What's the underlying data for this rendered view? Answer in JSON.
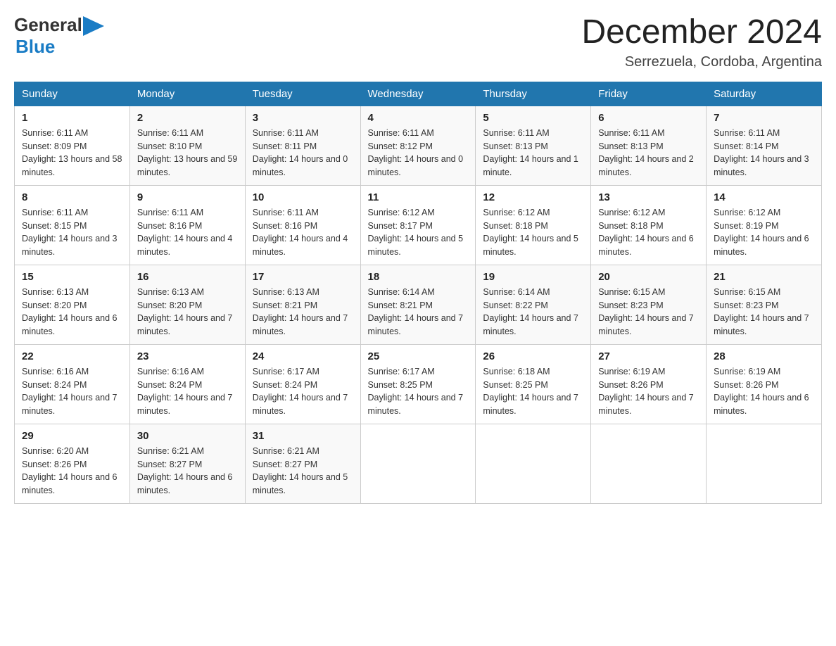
{
  "header": {
    "logo_general": "General",
    "logo_blue": "Blue",
    "title": "December 2024",
    "location": "Serrezuela, Cordoba, Argentina"
  },
  "days_of_week": [
    "Sunday",
    "Monday",
    "Tuesday",
    "Wednesday",
    "Thursday",
    "Friday",
    "Saturday"
  ],
  "weeks": [
    [
      {
        "day": "1",
        "sunrise": "Sunrise: 6:11 AM",
        "sunset": "Sunset: 8:09 PM",
        "daylight": "Daylight: 13 hours and 58 minutes."
      },
      {
        "day": "2",
        "sunrise": "Sunrise: 6:11 AM",
        "sunset": "Sunset: 8:10 PM",
        "daylight": "Daylight: 13 hours and 59 minutes."
      },
      {
        "day": "3",
        "sunrise": "Sunrise: 6:11 AM",
        "sunset": "Sunset: 8:11 PM",
        "daylight": "Daylight: 14 hours and 0 minutes."
      },
      {
        "day": "4",
        "sunrise": "Sunrise: 6:11 AM",
        "sunset": "Sunset: 8:12 PM",
        "daylight": "Daylight: 14 hours and 0 minutes."
      },
      {
        "day": "5",
        "sunrise": "Sunrise: 6:11 AM",
        "sunset": "Sunset: 8:13 PM",
        "daylight": "Daylight: 14 hours and 1 minute."
      },
      {
        "day": "6",
        "sunrise": "Sunrise: 6:11 AM",
        "sunset": "Sunset: 8:13 PM",
        "daylight": "Daylight: 14 hours and 2 minutes."
      },
      {
        "day": "7",
        "sunrise": "Sunrise: 6:11 AM",
        "sunset": "Sunset: 8:14 PM",
        "daylight": "Daylight: 14 hours and 3 minutes."
      }
    ],
    [
      {
        "day": "8",
        "sunrise": "Sunrise: 6:11 AM",
        "sunset": "Sunset: 8:15 PM",
        "daylight": "Daylight: 14 hours and 3 minutes."
      },
      {
        "day": "9",
        "sunrise": "Sunrise: 6:11 AM",
        "sunset": "Sunset: 8:16 PM",
        "daylight": "Daylight: 14 hours and 4 minutes."
      },
      {
        "day": "10",
        "sunrise": "Sunrise: 6:11 AM",
        "sunset": "Sunset: 8:16 PM",
        "daylight": "Daylight: 14 hours and 4 minutes."
      },
      {
        "day": "11",
        "sunrise": "Sunrise: 6:12 AM",
        "sunset": "Sunset: 8:17 PM",
        "daylight": "Daylight: 14 hours and 5 minutes."
      },
      {
        "day": "12",
        "sunrise": "Sunrise: 6:12 AM",
        "sunset": "Sunset: 8:18 PM",
        "daylight": "Daylight: 14 hours and 5 minutes."
      },
      {
        "day": "13",
        "sunrise": "Sunrise: 6:12 AM",
        "sunset": "Sunset: 8:18 PM",
        "daylight": "Daylight: 14 hours and 6 minutes."
      },
      {
        "day": "14",
        "sunrise": "Sunrise: 6:12 AM",
        "sunset": "Sunset: 8:19 PM",
        "daylight": "Daylight: 14 hours and 6 minutes."
      }
    ],
    [
      {
        "day": "15",
        "sunrise": "Sunrise: 6:13 AM",
        "sunset": "Sunset: 8:20 PM",
        "daylight": "Daylight: 14 hours and 6 minutes."
      },
      {
        "day": "16",
        "sunrise": "Sunrise: 6:13 AM",
        "sunset": "Sunset: 8:20 PM",
        "daylight": "Daylight: 14 hours and 7 minutes."
      },
      {
        "day": "17",
        "sunrise": "Sunrise: 6:13 AM",
        "sunset": "Sunset: 8:21 PM",
        "daylight": "Daylight: 14 hours and 7 minutes."
      },
      {
        "day": "18",
        "sunrise": "Sunrise: 6:14 AM",
        "sunset": "Sunset: 8:21 PM",
        "daylight": "Daylight: 14 hours and 7 minutes."
      },
      {
        "day": "19",
        "sunrise": "Sunrise: 6:14 AM",
        "sunset": "Sunset: 8:22 PM",
        "daylight": "Daylight: 14 hours and 7 minutes."
      },
      {
        "day": "20",
        "sunrise": "Sunrise: 6:15 AM",
        "sunset": "Sunset: 8:23 PM",
        "daylight": "Daylight: 14 hours and 7 minutes."
      },
      {
        "day": "21",
        "sunrise": "Sunrise: 6:15 AM",
        "sunset": "Sunset: 8:23 PM",
        "daylight": "Daylight: 14 hours and 7 minutes."
      }
    ],
    [
      {
        "day": "22",
        "sunrise": "Sunrise: 6:16 AM",
        "sunset": "Sunset: 8:24 PM",
        "daylight": "Daylight: 14 hours and 7 minutes."
      },
      {
        "day": "23",
        "sunrise": "Sunrise: 6:16 AM",
        "sunset": "Sunset: 8:24 PM",
        "daylight": "Daylight: 14 hours and 7 minutes."
      },
      {
        "day": "24",
        "sunrise": "Sunrise: 6:17 AM",
        "sunset": "Sunset: 8:24 PM",
        "daylight": "Daylight: 14 hours and 7 minutes."
      },
      {
        "day": "25",
        "sunrise": "Sunrise: 6:17 AM",
        "sunset": "Sunset: 8:25 PM",
        "daylight": "Daylight: 14 hours and 7 minutes."
      },
      {
        "day": "26",
        "sunrise": "Sunrise: 6:18 AM",
        "sunset": "Sunset: 8:25 PM",
        "daylight": "Daylight: 14 hours and 7 minutes."
      },
      {
        "day": "27",
        "sunrise": "Sunrise: 6:19 AM",
        "sunset": "Sunset: 8:26 PM",
        "daylight": "Daylight: 14 hours and 7 minutes."
      },
      {
        "day": "28",
        "sunrise": "Sunrise: 6:19 AM",
        "sunset": "Sunset: 8:26 PM",
        "daylight": "Daylight: 14 hours and 6 minutes."
      }
    ],
    [
      {
        "day": "29",
        "sunrise": "Sunrise: 6:20 AM",
        "sunset": "Sunset: 8:26 PM",
        "daylight": "Daylight: 14 hours and 6 minutes."
      },
      {
        "day": "30",
        "sunrise": "Sunrise: 6:21 AM",
        "sunset": "Sunset: 8:27 PM",
        "daylight": "Daylight: 14 hours and 6 minutes."
      },
      {
        "day": "31",
        "sunrise": "Sunrise: 6:21 AM",
        "sunset": "Sunset: 8:27 PM",
        "daylight": "Daylight: 14 hours and 5 minutes."
      },
      null,
      null,
      null,
      null
    ]
  ]
}
